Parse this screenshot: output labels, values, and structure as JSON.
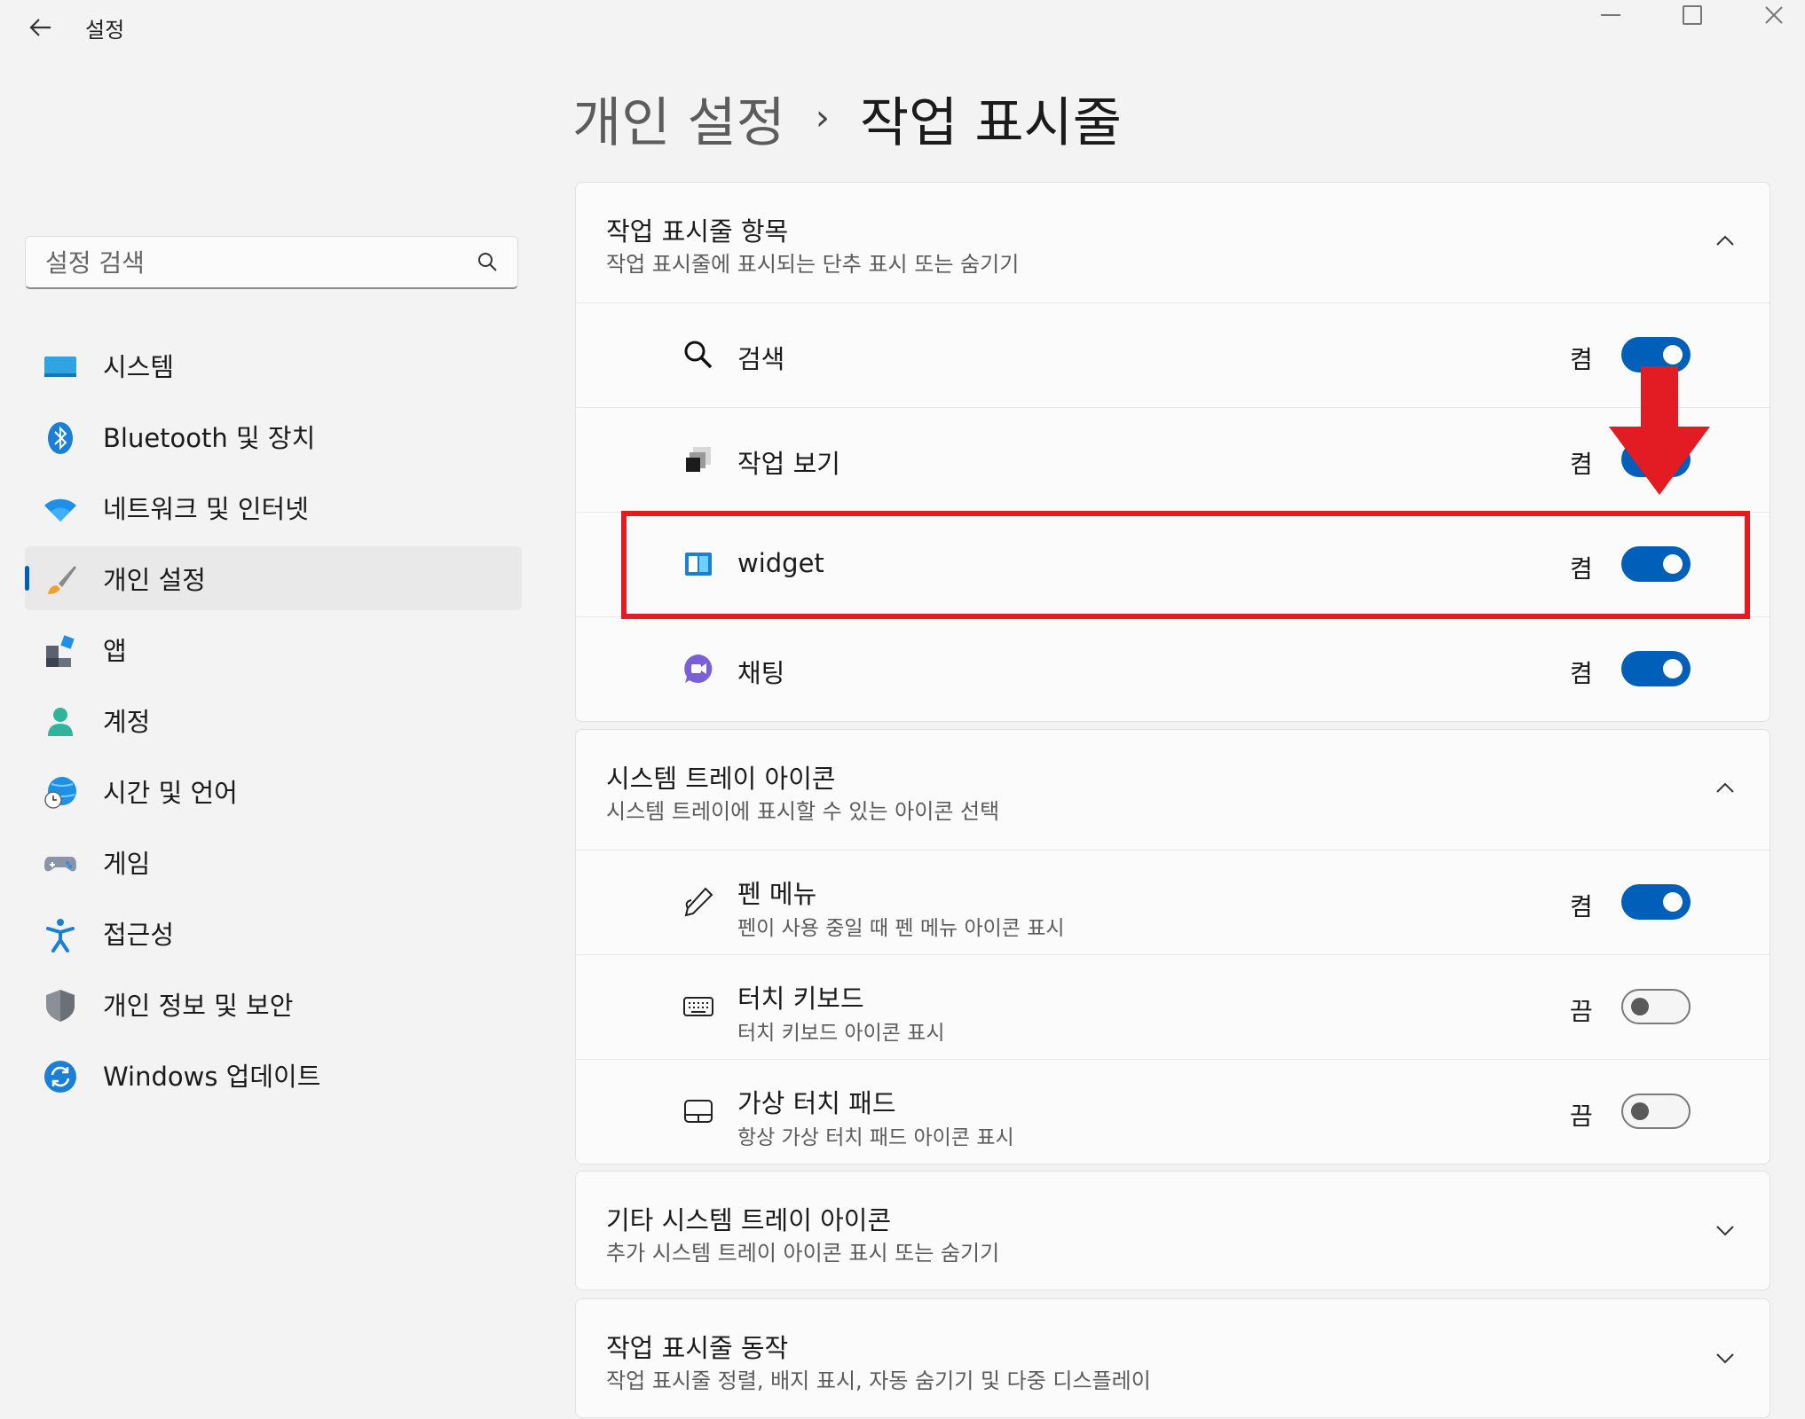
{
  "window": {
    "title": "설정",
    "back_icon": "arrow-left-icon"
  },
  "breadcrumb": {
    "parent": "개인 설정",
    "separator": "›",
    "current": "작업 표시줄"
  },
  "search": {
    "placeholder": "설정 검색",
    "value": ""
  },
  "sidebar": {
    "items": [
      {
        "label": "시스템",
        "icon": "display-icon",
        "active": false
      },
      {
        "label": "Bluetooth 및 장치",
        "icon": "bluetooth-icon",
        "active": false
      },
      {
        "label": "네트워크 및 인터넷",
        "icon": "wifi-icon",
        "active": false
      },
      {
        "label": "개인 설정",
        "icon": "paintbrush-icon",
        "active": true
      },
      {
        "label": "앱",
        "icon": "apps-icon",
        "active": false
      },
      {
        "label": "계정",
        "icon": "account-icon",
        "active": false
      },
      {
        "label": "시간 및 언어",
        "icon": "globe-clock-icon",
        "active": false
      },
      {
        "label": "게임",
        "icon": "gamepad-icon",
        "active": false
      },
      {
        "label": "접근성",
        "icon": "accessibility-icon",
        "active": false
      },
      {
        "label": "개인 정보 및 보안",
        "icon": "shield-icon",
        "active": false
      },
      {
        "label": "Windows 업데이트",
        "icon": "update-icon",
        "active": false
      }
    ]
  },
  "sections": {
    "taskbar_items": {
      "title": "작업 표시줄 항목",
      "subtitle": "작업 표시줄에 표시되는 단추 표시 또는 숨기기",
      "expanded": true,
      "rows": [
        {
          "label": "검색",
          "state": "켬",
          "on": true,
          "icon": "search-icon"
        },
        {
          "label": "작업 보기",
          "state": "켬",
          "on": true,
          "icon": "task-view-icon"
        },
        {
          "label": "widget",
          "state": "켬",
          "on": true,
          "icon": "widgets-icon"
        },
        {
          "label": "채팅",
          "state": "켬",
          "on": true,
          "icon": "chat-icon"
        }
      ]
    },
    "system_tray": {
      "title": "시스템 트레이 아이콘",
      "subtitle": "시스템 트레이에 표시할 수 있는 아이콘 선택",
      "expanded": true,
      "rows": [
        {
          "label": "펜 메뉴",
          "desc": "펜이 사용 중일 때 펜 메뉴 아이콘 표시",
          "state": "켬",
          "on": true,
          "icon": "pen-icon"
        },
        {
          "label": "터치 키보드",
          "desc": "터치 키보드 아이콘 표시",
          "state": "끔",
          "on": false,
          "icon": "keyboard-icon"
        },
        {
          "label": "가상 터치 패드",
          "desc": "항상 가상 터치 패드 아이콘 표시",
          "state": "끔",
          "on": false,
          "icon": "touchpad-icon"
        }
      ]
    },
    "other_tray": {
      "title": "기타 시스템 트레이 아이콘",
      "subtitle": "추가 시스템 트레이 아이콘 표시 또는 숨기기",
      "expanded": false
    },
    "taskbar_behavior": {
      "title": "작업 표시줄 동작",
      "subtitle": "작업 표시줄 정렬, 배지 표시, 자동 숨기기 및 다중 디스플레이",
      "expanded": false
    }
  },
  "colors": {
    "accent": "#005fb8",
    "annotation": "#e31b23",
    "background": "#f3f3f3",
    "card": "#fbfbfb"
  }
}
